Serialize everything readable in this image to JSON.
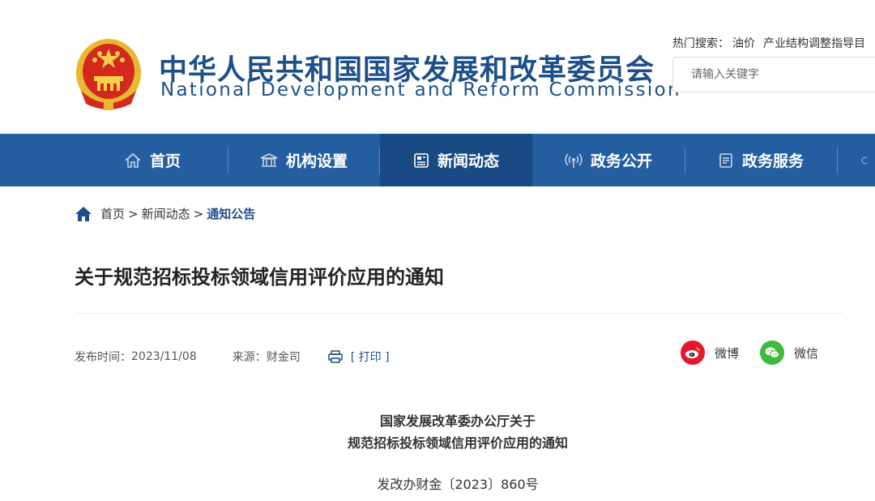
{
  "header": {
    "brand_cn": "中华人民共和国国家发展和改革委员会",
    "brand_en": "National Development and Reform Commission",
    "hot_label": "热门搜索：",
    "hot_items": [
      "油价",
      "产业结构调整指导目"
    ],
    "search_placeholder": "请输入关键字",
    "emblem_icon": "national-emblem-icon"
  },
  "nav": {
    "items": [
      {
        "label": "首页",
        "icon": "home-icon"
      },
      {
        "label": "机构设置",
        "icon": "institution-icon"
      },
      {
        "label": "新闻动态",
        "icon": "news-icon"
      },
      {
        "label": "政务公开",
        "icon": "broadcast-icon"
      },
      {
        "label": "政务服务",
        "icon": "document-icon"
      }
    ],
    "active_index": 2
  },
  "breadcrumb": {
    "home": "首页",
    "sep1": ">",
    "section": "新闻动态",
    "sep2": ">",
    "current": "通知公告"
  },
  "article": {
    "title": "关于规范招标投标领域信用评价应用的通知",
    "publish_label": "发布时间：",
    "publish_date": "2023/11/08",
    "source_label": "来源：",
    "source": "财金司",
    "print_label": "[ 打印 ]",
    "share": {
      "weibo": "微博",
      "wechat": "微信"
    },
    "doc_heading_line1": "国家发展改革委办公厅关于",
    "doc_heading_line2": "规范招标投标领域信用评价应用的通知",
    "doc_number": "发改办财金〔2023〕860号"
  },
  "colors": {
    "brand_blue": "#1d4f8a",
    "nav_bg": "#245ea1",
    "nav_active": "#1a4a84",
    "weibo_red": "#e6162d",
    "wechat_green": "#3dbb3c"
  }
}
